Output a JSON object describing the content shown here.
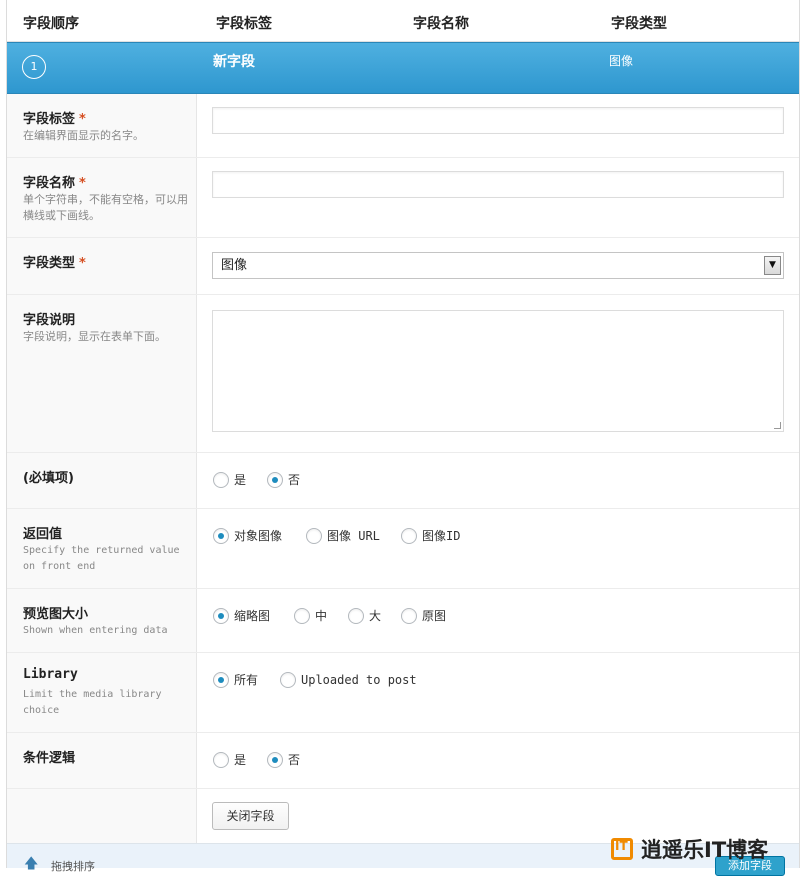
{
  "table_header": {
    "order": "字段顺序",
    "label": "字段标签",
    "name": "字段名称",
    "type": "字段类型"
  },
  "field_bar": {
    "order_number": "1",
    "label": "新字段",
    "type": "图像"
  },
  "rows": {
    "field_label": {
      "title": "字段标签",
      "required": "*",
      "desc": "在编辑界面显示的名字。",
      "value": ""
    },
    "field_name": {
      "title": "字段名称",
      "required": "*",
      "desc": "单个字符串，不能有空格，可以用横线或下画线。",
      "value": ""
    },
    "field_type": {
      "title": "字段类型",
      "required": "*",
      "selected": "图像"
    },
    "field_instructions": {
      "title": "字段说明",
      "desc": "字段说明，显示在表单下面。",
      "value": ""
    },
    "required": {
      "title": "(必填项)",
      "options": [
        "是",
        "否"
      ],
      "selected": "否"
    },
    "return_value": {
      "title": "返回值",
      "desc": "Specify the returned value on front end",
      "options": [
        "对象图像",
        "图像 URL",
        "图像ID"
      ],
      "selected": "对象图像"
    },
    "preview_size": {
      "title": "预览图大小",
      "desc": "Shown when entering data",
      "options": [
        "缩略图",
        "中",
        "大",
        "原图"
      ],
      "selected": "缩略图"
    },
    "library": {
      "title": "Library",
      "desc": "Limit the media library choice",
      "options": [
        "所有",
        "Uploaded to post"
      ],
      "selected": "所有"
    },
    "conditional_logic": {
      "title": "条件逻辑",
      "options": [
        "是",
        "否"
      ],
      "selected": "否"
    }
  },
  "close_button": "关闭字段",
  "footer": {
    "hint": "拖拽排序",
    "add_button": "添加字段"
  },
  "watermark": "逍遥乐IT博客",
  "colors": {
    "accent": "#2e97cf",
    "radio_checked": "#1e8cbe",
    "required": "#d54e21"
  },
  "icons": {
    "sort": "arrow-up-icon",
    "select": "chevron-down-icon"
  }
}
